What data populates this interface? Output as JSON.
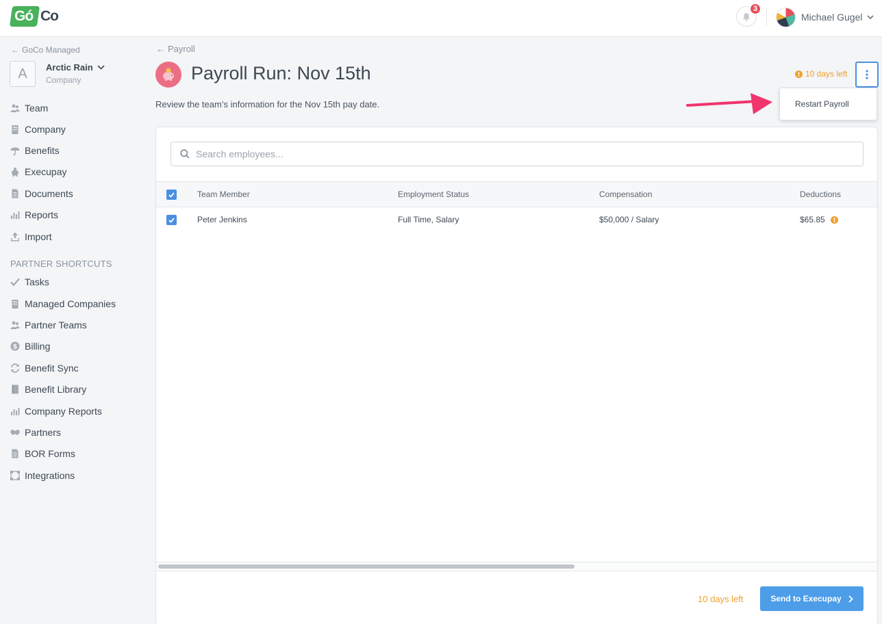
{
  "brand": {
    "logo_go": "Gó",
    "logo_co": "Co",
    "green": "#49b25b"
  },
  "header": {
    "notification_count": "3",
    "user_name": "Michael Gugel"
  },
  "sidebar": {
    "back_label": "GoCo Managed",
    "company_initial": "A",
    "company_name": "Arctic Rain",
    "company_sub": "Company",
    "items": [
      {
        "label": "Team",
        "icon": "team-icon"
      },
      {
        "label": "Company",
        "icon": "building-icon"
      },
      {
        "label": "Benefits",
        "icon": "umbrella-icon"
      },
      {
        "label": "Execupay",
        "icon": "piggy-bank-icon"
      },
      {
        "label": "Documents",
        "icon": "document-icon"
      },
      {
        "label": "Reports",
        "icon": "bar-chart-icon"
      },
      {
        "label": "Import",
        "icon": "upload-icon"
      }
    ],
    "section_title": "PARTNER SHORTCUTS",
    "partner_items": [
      {
        "label": "Tasks",
        "icon": "check-icon"
      },
      {
        "label": "Managed Companies",
        "icon": "building-icon"
      },
      {
        "label": "Partner Teams",
        "icon": "team-icon"
      },
      {
        "label": "Billing",
        "icon": "dollar-icon"
      },
      {
        "label": "Benefit Sync",
        "icon": "sync-icon"
      },
      {
        "label": "Benefit Library",
        "icon": "book-icon"
      },
      {
        "label": "Company Reports",
        "icon": "bar-chart-icon"
      },
      {
        "label": "Partners",
        "icon": "handshake-icon"
      },
      {
        "label": "BOR Forms",
        "icon": "document-icon"
      },
      {
        "label": "Integrations",
        "icon": "integration-icon"
      }
    ]
  },
  "page": {
    "back_label": "Payroll",
    "title": "Payroll Run: Nov 15th",
    "description": "Review the team’s information for the Nov 15th pay date.",
    "days_left": "10 days left",
    "menu": {
      "restart_label": "Restart Payroll"
    },
    "accent": "#f0a030",
    "primary": "#4d9de8"
  },
  "table": {
    "search_placeholder": "Search employees...",
    "columns": [
      "Team Member",
      "Employment Status",
      "Compensation",
      "Deductions"
    ],
    "rows": [
      {
        "name": "Peter Jenkins",
        "status": "Full Time, Salary",
        "compensation": "$50,000 / Salary",
        "deductions": "$65.85"
      }
    ]
  },
  "footer": {
    "days_left": "10 days left",
    "send_label": "Send to Execupay"
  }
}
